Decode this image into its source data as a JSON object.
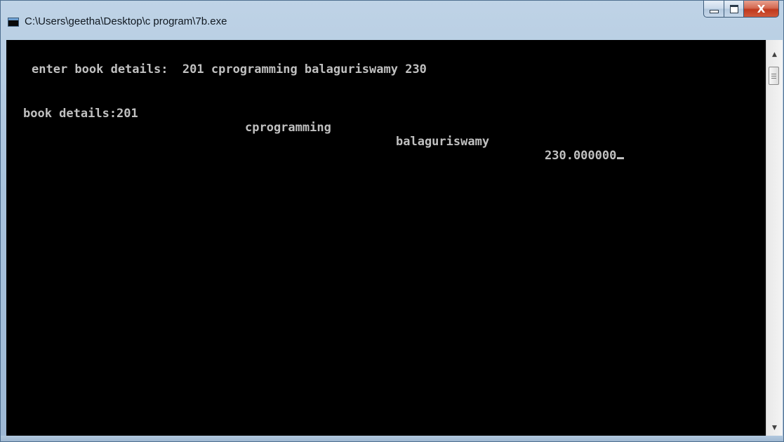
{
  "window": {
    "title": "C:\\Users\\geetha\\Desktop\\c program\\7b.exe",
    "icon": "console-app-icon",
    "controls": {
      "minimize_icon": "minimize-icon",
      "maximize_icon": "maximize-icon",
      "close_label": "X"
    }
  },
  "console": {
    "line1": "enter book details:  201 cprogramming balaguriswamy 230",
    "line2": {
      "label": "book details:201",
      "title": "cprogramming",
      "author": "balaguriswamy",
      "price": "230.000000"
    },
    "colors": {
      "background": "#000000",
      "foreground": "#c0c0c0"
    }
  },
  "scrollbar": {
    "up_arrow": "▲",
    "down_arrow": "▼"
  }
}
